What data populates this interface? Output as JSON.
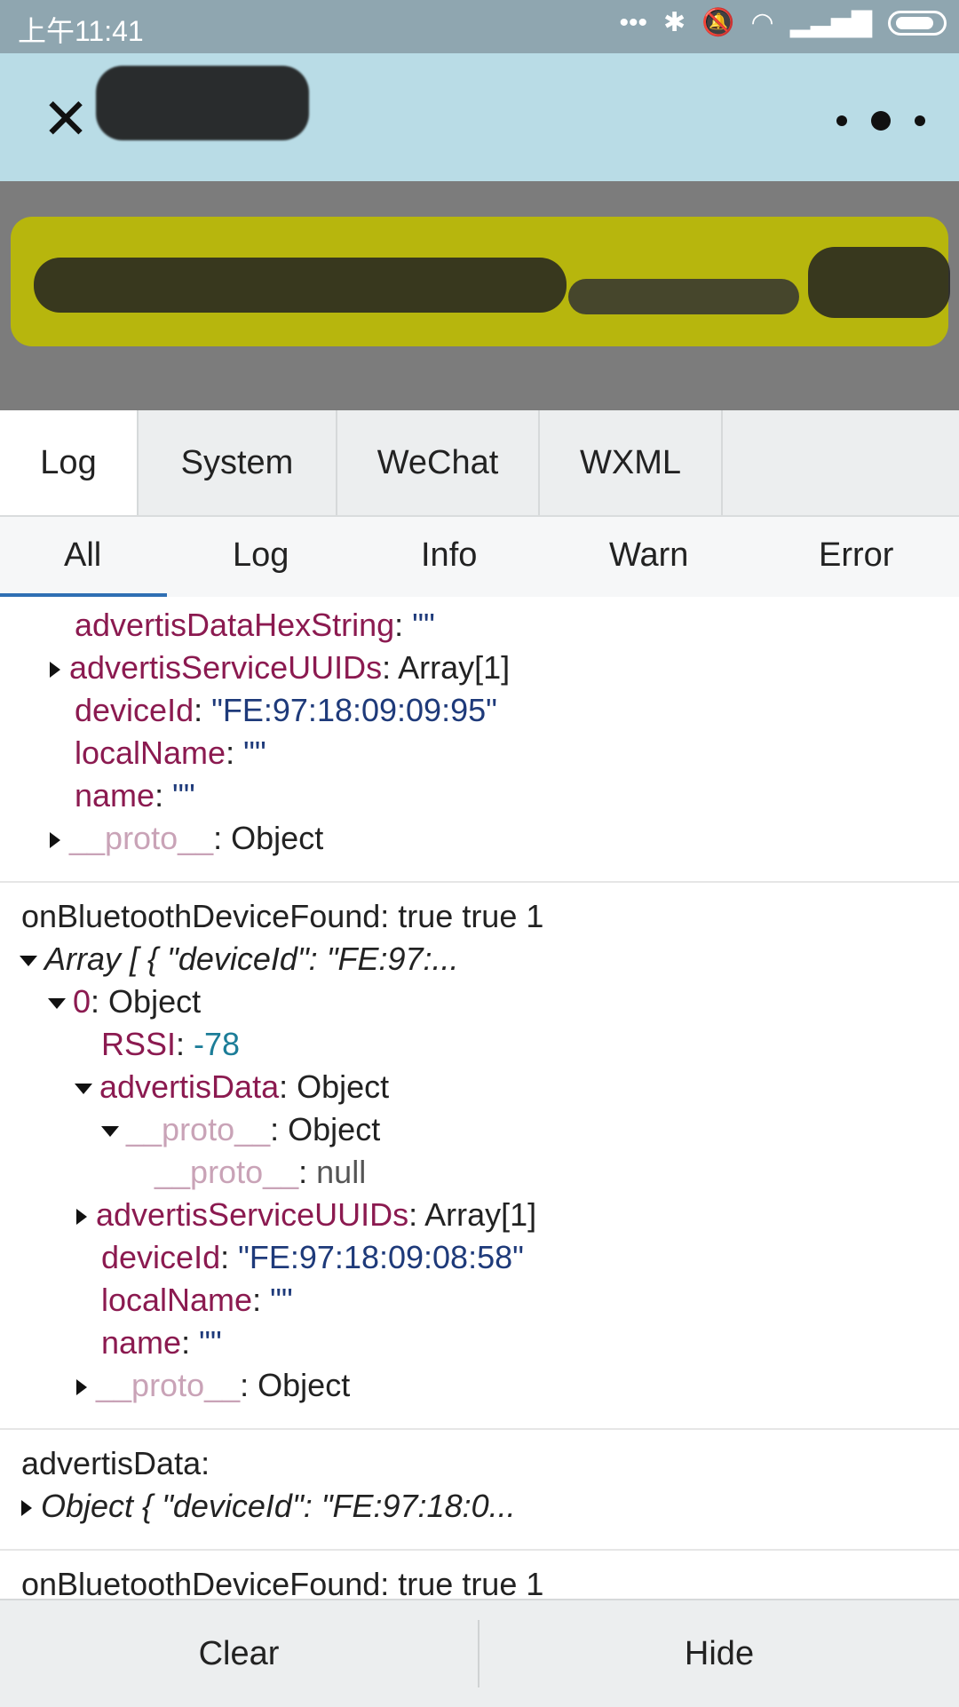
{
  "status_bar": {
    "time": "上午11:41"
  },
  "console": {
    "tabs": [
      "Log",
      "System",
      "WeChat",
      "WXML"
    ],
    "filters": [
      "All",
      "Log",
      "Info",
      "Warn",
      "Error"
    ],
    "entries": {
      "e1": {
        "advertisDataHexString_key": "advertisDataHexString",
        "advertisDataHexString_val": "\"\"",
        "advertisServiceUUIDs_key": "advertisServiceUUIDs",
        "advertisServiceUUIDs_val": "Array[1]",
        "deviceId_key": "deviceId",
        "deviceId_val": "\"FE:97:18:09:09:95\"",
        "localName_key": "localName",
        "localName_val": "\"\"",
        "name_key": "name",
        "name_val": "\"\"",
        "proto_key": "__proto__",
        "proto_val": "Object"
      },
      "e2": {
        "header": "onBluetoothDeviceFound: true true 1",
        "array_summary": "Array [ { \"deviceId\": \"FE:97:...",
        "index_key": "0",
        "index_val": "Object",
        "rssi_key": "RSSI",
        "rssi_val": "-78",
        "advertisData_key": "advertisData",
        "advertisData_val": "Object",
        "proto1_key": "__proto__",
        "proto1_val": "Object",
        "proto2_key": "__proto__",
        "proto2_val": "null",
        "advertisServiceUUIDs_key": "advertisServiceUUIDs",
        "advertisServiceUUIDs_val": "Array[1]",
        "deviceId_key": "deviceId",
        "deviceId_val": "\"FE:97:18:09:08:58\"",
        "localName_key": "localName",
        "localName_val": "\"\"",
        "name_key": "name",
        "name_val": "\"\"",
        "proto_key": "__proto__",
        "proto_val": "Object"
      },
      "e3": {
        "header": "advertisData:",
        "summary": "Object { \"deviceId\": \"FE:97:18:0..."
      },
      "e4": {
        "header": "onBluetoothDeviceFound: true true 1"
      }
    },
    "buttons": {
      "clear": "Clear",
      "hide": "Hide"
    }
  }
}
